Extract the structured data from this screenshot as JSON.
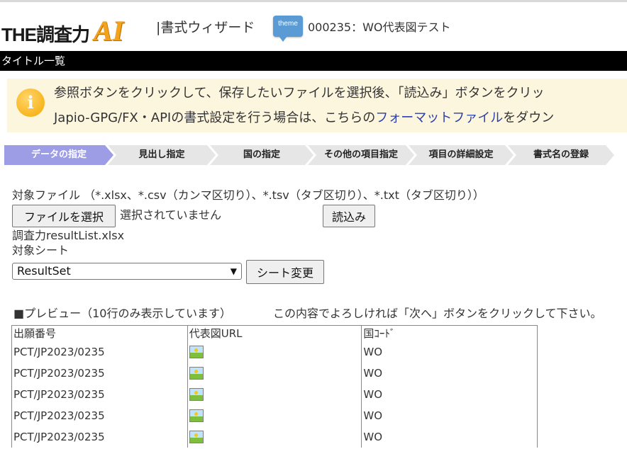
{
  "header": {
    "logo_text": "THE調査力",
    "logo_ai": "AI",
    "wizard_title": "|書式ウィザード",
    "theme_icon_text": "theme",
    "theme_label": "000235：WO代表図テスト"
  },
  "titlebar": {
    "text": "タイトル一覧"
  },
  "notice": {
    "icon": "info-icon",
    "line1": "参照ボタンをクリックして、保存したいファイルを選択後、「読込み」ボタンをクリッ",
    "line2_pre": "Japio-GPG/FX・APIの書式設定を行う場合は、こちらの",
    "line2_link": "フォーマットファイル",
    "line2_post": "をダウン"
  },
  "steps": [
    {
      "label": "データの指定",
      "active": true
    },
    {
      "label": "見出し指定",
      "active": false
    },
    {
      "label": "国の指定",
      "active": false
    },
    {
      "label": "その他の項目指定",
      "active": false
    },
    {
      "label": "項目の詳細設定",
      "active": false
    },
    {
      "label": "書式名の登録",
      "active": false
    }
  ],
  "form": {
    "file_label": "対象ファイル （*.xlsx、*.csv（カンマ区切り）、*.tsv（タブ区切り）、*.txt（タブ区切り））",
    "choose_file_button": "ファイルを選択",
    "no_file_text": "選択されていません",
    "load_button": "読込み",
    "loaded_file": "調査力resultList.xlsx",
    "sheet_label": "対象シート",
    "sheet_selected": "ResultSet",
    "sheet_change_button": "シート変更"
  },
  "preview": {
    "label": "■プレビュー（10行のみ表示しています）",
    "hint": "この内容でよろしければ「次へ」ボタンをクリックして下さい。",
    "columns": [
      "出願番号",
      "代表図URL",
      "国ｺｰﾄﾞ"
    ],
    "rows": [
      {
        "number": "PCT/JP2023/0235",
        "image": "image-icon",
        "country": "WO"
      },
      {
        "number": "PCT/JP2023/0235",
        "image": "image-icon",
        "country": "WO"
      },
      {
        "number": "PCT/JP2023/0235",
        "image": "image-icon",
        "country": "WO"
      },
      {
        "number": "PCT/JP2023/0235",
        "image": "image-icon",
        "country": "WO"
      },
      {
        "number": "PCT/JP2023/0235",
        "image": "image-icon",
        "country": "WO"
      }
    ]
  }
}
